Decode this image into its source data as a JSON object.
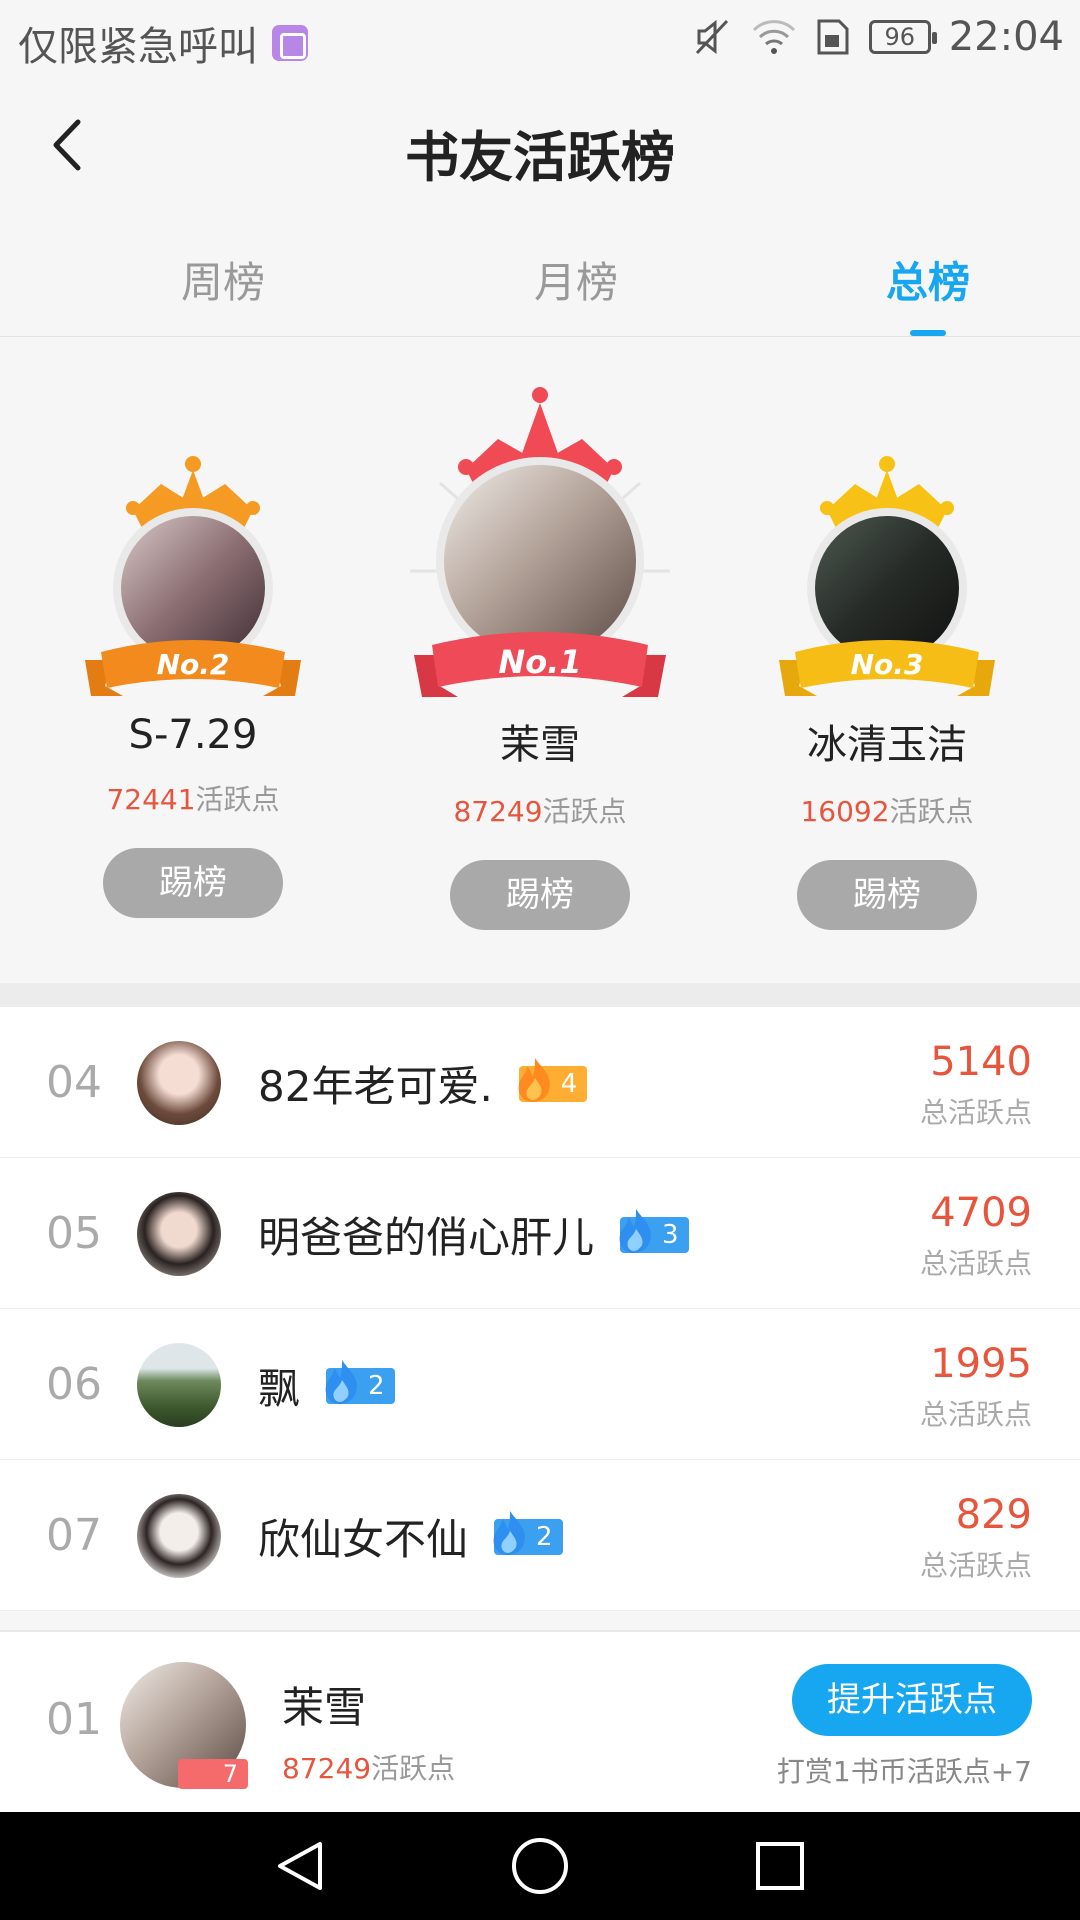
{
  "status_bar": {
    "carrier_text": "仅限紧急呼叫",
    "battery_level": "96",
    "time": "22:04",
    "icons": [
      "gallery-icon",
      "mute-icon",
      "wifi-icon",
      "sim-icon",
      "battery-icon"
    ]
  },
  "header": {
    "title": "书友活跃榜",
    "back_icon": "chevron-left-icon"
  },
  "tabs": [
    {
      "label": "周榜",
      "active": false
    },
    {
      "label": "月榜",
      "active": false
    },
    {
      "label": "总榜",
      "active": true
    }
  ],
  "podium": [
    {
      "rank_label": "No.2",
      "name": "S-7.29",
      "points": "72441",
      "points_suffix": "活跃点",
      "button": "踢榜",
      "crown_color": "#f59a23"
    },
    {
      "rank_label": "No.1",
      "name": "茉雪",
      "points": "87249",
      "points_suffix": "活跃点",
      "button": "踢榜",
      "crown_color": "#f04a55"
    },
    {
      "rank_label": "No.3",
      "name": "冰清玉洁",
      "points": "16092",
      "points_suffix": "活跃点",
      "button": "踢榜",
      "crown_color": "#f7c215"
    }
  ],
  "list": [
    {
      "rank": "04",
      "name": "82年老可爱.",
      "level": "4",
      "level_color": "orange",
      "points": "5140",
      "points_label": "总活跃点"
    },
    {
      "rank": "05",
      "name": "明爸爸的俏心肝儿",
      "level": "3",
      "level_color": "blue",
      "points": "4709",
      "points_label": "总活跃点"
    },
    {
      "rank": "06",
      "name": "飘",
      "level": "2",
      "level_color": "blue",
      "points": "1995",
      "points_label": "总活跃点"
    },
    {
      "rank": "07",
      "name": "欣仙女不仙",
      "level": "2",
      "level_color": "blue",
      "points": "829",
      "points_label": "总活跃点"
    }
  ],
  "my_rank": {
    "rank": "01",
    "name": "茉雪",
    "level": "7",
    "points": "87249",
    "points_suffix": "活跃点",
    "button": "提升活跃点",
    "hint": "打赏1书币活跃点+7"
  },
  "nav": [
    "back-triangle-icon",
    "home-circle-icon",
    "recents-square-icon"
  ],
  "colors": {
    "accent": "#17a6f0",
    "points": "#e8553d",
    "kick_button": "#a9a9a9"
  }
}
